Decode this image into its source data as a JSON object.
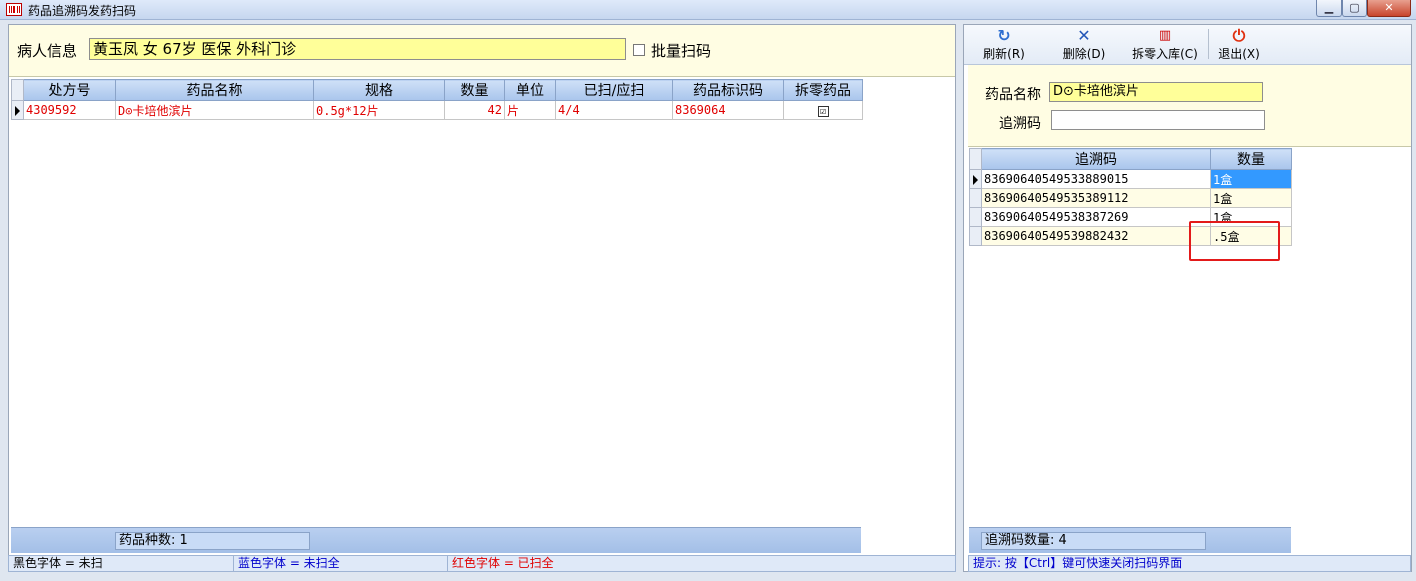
{
  "window": {
    "title": "药品追溯码发药扫码",
    "controls": {
      "minimize": "▁",
      "maximize": "▢",
      "close": "✕"
    }
  },
  "left": {
    "patient_label": "病人信息",
    "patient_value": "黄玉凤 女 67岁 医保 外科门诊",
    "batch_label": "批量扫码",
    "batch_checked": false,
    "columns": [
      "处方号",
      "药品名称",
      "规格",
      "数量",
      "单位",
      "已扫/应扫",
      "药品标识码",
      "拆零药品"
    ],
    "rows": [
      {
        "rx_no": "4309592",
        "name": "D⊙卡培他滨片",
        "spec": "0.5g*12片",
        "qty": "42",
        "unit": "片",
        "scanned": "4/4",
        "code": "8369064",
        "split": "☑"
      }
    ],
    "footer_count": "药品种数: 1"
  },
  "legend": {
    "black": "黑色字体 = 未扫",
    "blue": "蓝色字体 = 未扫全",
    "red": "红色字体 = 已扫全",
    "colors": {
      "black": "#000000",
      "blue": "#0000cc",
      "red": "#e00000"
    }
  },
  "right": {
    "toolbar": [
      {
        "label": "刷新(R)",
        "icon": "refresh-icon"
      },
      {
        "label": "删除(D)",
        "icon": "delete-icon"
      },
      {
        "label": "拆零入库(C)",
        "icon": "barcode-icon"
      },
      {
        "label": "退出(X)",
        "icon": "power-icon"
      }
    ],
    "drug_name_label": "药品名称",
    "drug_name_value": "D⊙卡培他滨片",
    "trace_label": "追溯码",
    "trace_value": "",
    "columns": [
      "追溯码",
      "数量"
    ],
    "rows": [
      {
        "code": "83690640549533889015",
        "qty": "1盒"
      },
      {
        "code": "83690640549535389112",
        "qty": "1盒"
      },
      {
        "code": "83690640549538387269",
        "qty": "1盒"
      },
      {
        "code": "83690640549539882432",
        "qty": ".5盒"
      }
    ],
    "footer_count": "追溯码数量: 4",
    "hint": "提示: 按【Ctrl】键可快速关闭扫码界面"
  }
}
